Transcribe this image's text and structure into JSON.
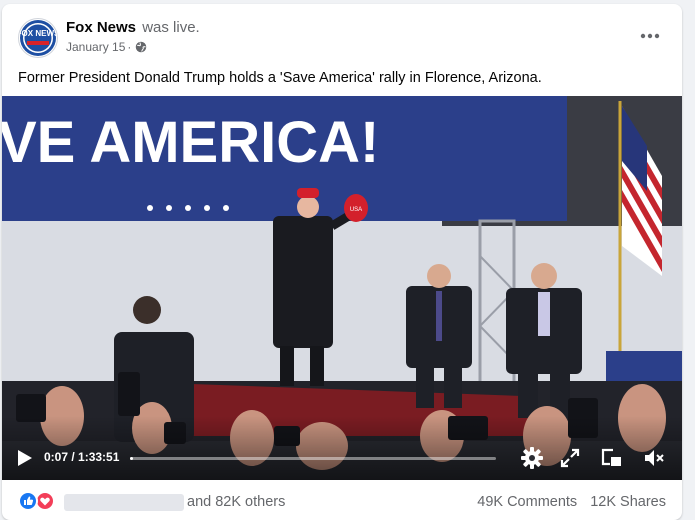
{
  "post": {
    "page_name": "Fox News",
    "live_status": "was live.",
    "date": "January 15",
    "separator": "·",
    "privacy_icon": "globe-icon",
    "more_icon": "more-horizontal-icon",
    "text": "Former President Donald Trump holds a 'Save America' rally in Florence, Arizona.",
    "avatar_logo": "FOX NEWS"
  },
  "video": {
    "banner_text": "VE AMERICA!",
    "cap_text": "USA",
    "current_time": "0:07",
    "duration": "1:33:51",
    "time_display": "0:07 / 1:33:51",
    "progress_fraction": 0.0012,
    "icons": [
      "play-icon",
      "settings-icon",
      "fullscreen-icon",
      "picture-in-picture-icon",
      "volume-muted-icon"
    ]
  },
  "engagement": {
    "reaction_icons": [
      "like-icon",
      "love-icon"
    ],
    "others_text": "and 82K others",
    "comments": "49K Comments",
    "shares": "12K Shares"
  },
  "colors": {
    "banner_blue": "#2b3f8a",
    "fox_blue": "#1e4fa3",
    "fox_red": "#d8232a",
    "like_blue": "#1877f2",
    "love_red": "#f33e58",
    "secondary_text": "#65676b"
  }
}
